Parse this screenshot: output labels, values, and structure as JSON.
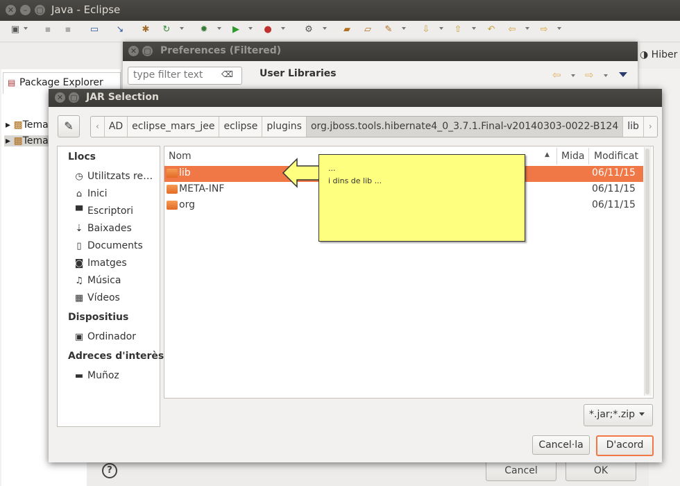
{
  "window": {
    "title": "Java - Eclipse"
  },
  "eclipse": {
    "hiber_tab": "Hiber",
    "package_explorer": {
      "title": "Package Explorer",
      "items": [
        "Tema",
        "Tema"
      ]
    }
  },
  "preferences": {
    "title": "Preferences (Filtered)",
    "filter_placeholder": "type filter text",
    "heading": "User Libraries",
    "cancel_label": "Cancel",
    "ok_label": "OK"
  },
  "jar_dialog": {
    "title": "JAR Selection",
    "breadcrumb": [
      "AD",
      "eclipse_mars_jee",
      "eclipse",
      "plugins",
      "org.jboss.tools.hibernate4_0_3.7.1.Final-v20140303-0022-B124",
      "lib"
    ],
    "places": {
      "heading_places": "Llocs",
      "items": [
        {
          "icon": "clock-icon",
          "label": "Utilitzats re…"
        },
        {
          "icon": "home-icon",
          "label": "Inici"
        },
        {
          "icon": "desktop-icon",
          "label": "Escriptori"
        },
        {
          "icon": "download-icon",
          "label": "Baixades"
        },
        {
          "icon": "document-icon",
          "label": "Documents"
        },
        {
          "icon": "camera-icon",
          "label": "Imatges"
        },
        {
          "icon": "music-icon",
          "label": "Música"
        },
        {
          "icon": "film-icon",
          "label": "Vídeos"
        }
      ],
      "heading_devices": "Dispositius",
      "devices": [
        {
          "icon": "computer-icon",
          "label": "Ordinador"
        }
      ],
      "heading_bookmarks": "Adreces d'interès",
      "bookmarks": [
        {
          "icon": "folder-icon",
          "label": "Muñoz"
        }
      ]
    },
    "columns": {
      "name": "Nom",
      "size": "Mida",
      "modified": "Modificat"
    },
    "rows": [
      {
        "name": "lib",
        "size": "",
        "modified": "06/11/15",
        "selected": true
      },
      {
        "name": "META-INF",
        "size": "",
        "modified": "06/11/15",
        "selected": false
      },
      {
        "name": "org",
        "size": "",
        "modified": "06/11/15",
        "selected": false
      }
    ],
    "filter": "*.jar;*.zip",
    "cancel_label": "Cancel·la",
    "ok_label": "D'acord"
  },
  "callout": {
    "line1": "...",
    "line2": "i dins de lib ..."
  },
  "colors": {
    "selection": "#f07746",
    "callout": "#ffff7f",
    "titlebar": "#3b3a36"
  }
}
